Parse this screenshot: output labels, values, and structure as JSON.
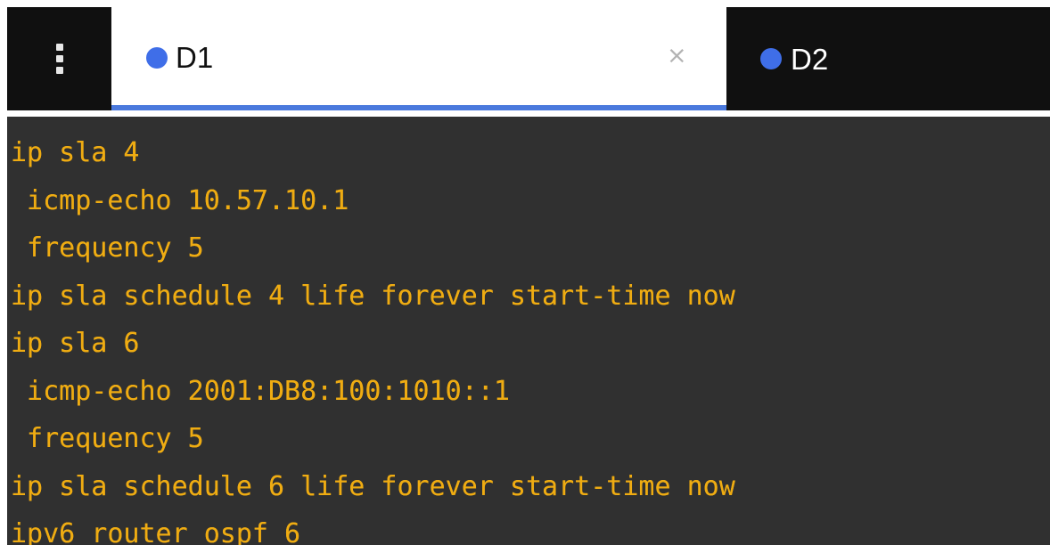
{
  "tabs": [
    {
      "label": "D1",
      "active": true,
      "status_color": "#3f6ee8",
      "close_icon": "close-icon"
    },
    {
      "label": "D2",
      "active": false,
      "status_color": "#3f6ee8"
    }
  ],
  "toolbar": {
    "menu_icon": "kebab-menu-icon"
  },
  "terminal": {
    "lines": [
      "ip sla 4",
      " icmp-echo 10.57.10.1",
      " frequency 5",
      "ip sla schedule 4 life forever start-time now",
      "ip sla 6",
      " icmp-echo 2001:DB8:100:1010::1",
      " frequency 5",
      "ip sla schedule 6 life forever start-time now",
      "ipv6 router ospf 6"
    ]
  },
  "colors": {
    "tabbar_background": "#101010",
    "active_tab_background": "#ffffff",
    "active_tab_underline": "#4a79dd",
    "terminal_background": "#303030",
    "terminal_text": "#efac12"
  }
}
